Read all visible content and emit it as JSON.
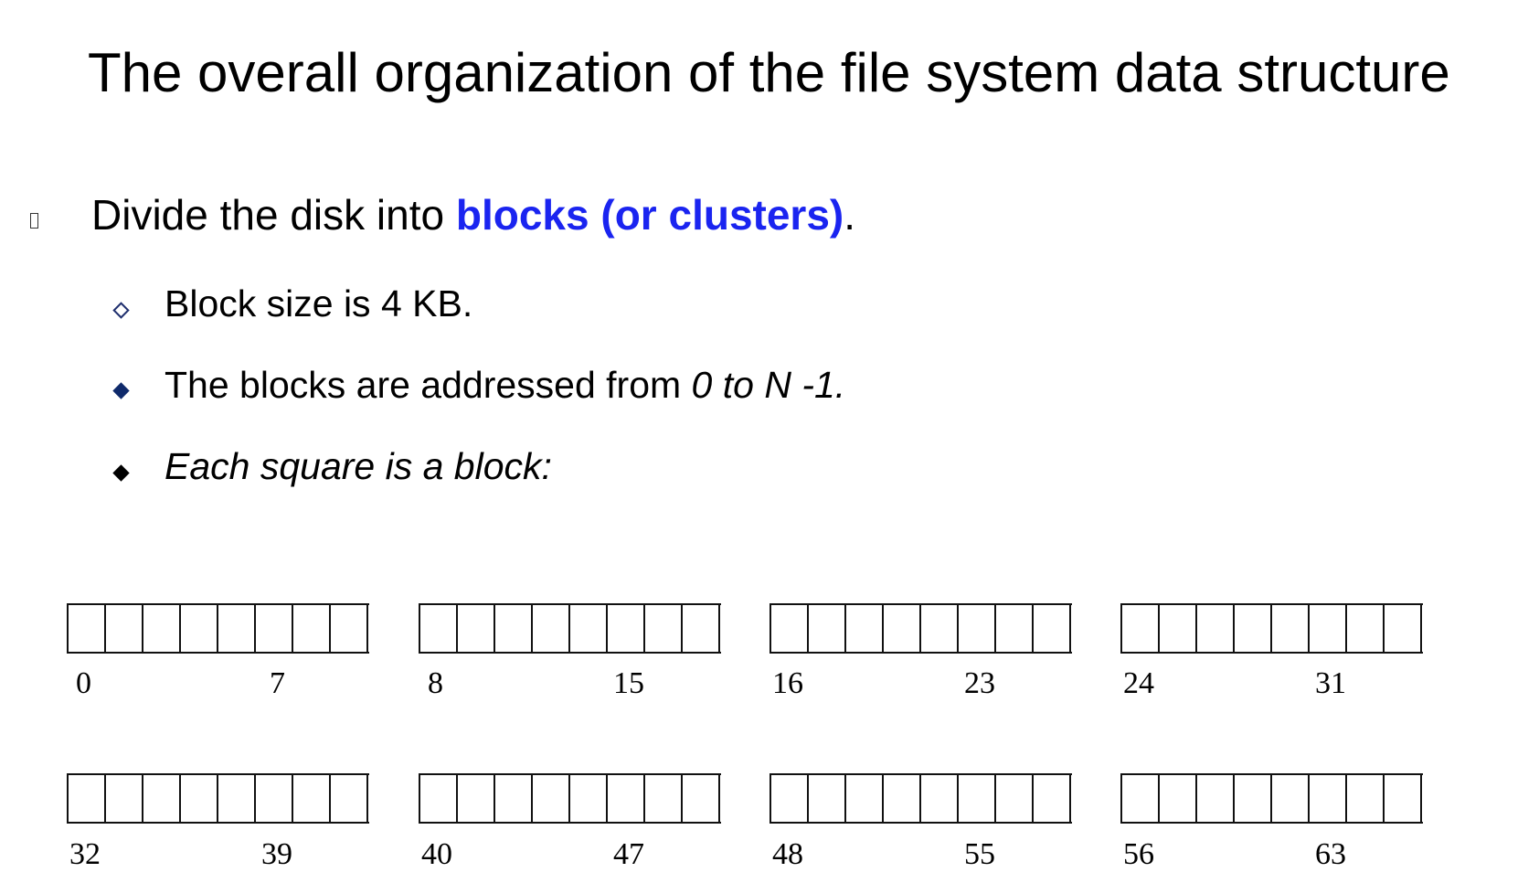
{
  "slide": {
    "title": "The overall organization of the file system data structure"
  },
  "bullets": {
    "main": {
      "prefix": "Divide the disk into ",
      "highlight": "blocks (or clusters)",
      "suffix": ".",
      "highlight_color": "#1a24f0"
    },
    "sub": [
      {
        "text": "Block size is 4 KB.",
        "marker": "hollow-diamond"
      },
      {
        "text_plain": "The blocks are addressed from ",
        "text_italic": "0 to N -1.",
        "marker": "navy-diamond"
      },
      {
        "text_italic": "Each square is a block:",
        "marker": "black-diamond"
      }
    ]
  },
  "blocks": {
    "groups": [
      {
        "start": "0",
        "end": "7"
      },
      {
        "start": "8",
        "end": "15"
      },
      {
        "start": "16",
        "end": "23"
      },
      {
        "start": "24",
        "end": "31"
      },
      {
        "start": "32",
        "end": "39"
      },
      {
        "start": "40",
        "end": "47"
      },
      {
        "start": "48",
        "end": "55"
      },
      {
        "start": "56",
        "end": "63"
      }
    ],
    "cells_per_group": 8
  }
}
